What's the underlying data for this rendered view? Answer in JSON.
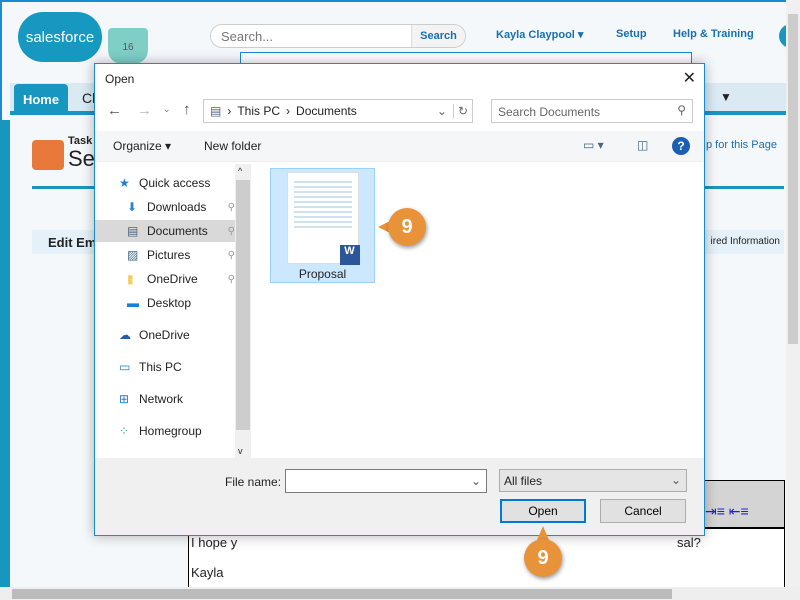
{
  "header": {
    "logo": "salesforce",
    "mug_badge": "16",
    "search_placeholder": "Search...",
    "search_button": "Search",
    "user": "Kayla Claypool",
    "setup": "Setup",
    "help": "Help & Training"
  },
  "tabs": {
    "home": "Home",
    "next": "Cl"
  },
  "page": {
    "breadcrumb": "Task",
    "title": "Se",
    "help_link": "p for this Page",
    "edit_header": "Edit Em",
    "required": "ired Information",
    "body_line1": "I hope y",
    "body_line1_end": "sal?",
    "signature": "Kayla"
  },
  "dialog": {
    "title": "Open",
    "path": [
      "This PC",
      "Documents"
    ],
    "search_placeholder": "Search Documents",
    "organize": "Organize",
    "new_folder": "New folder",
    "nav": [
      {
        "label": "Quick access",
        "icon": "star-icon"
      },
      {
        "label": "Downloads",
        "icon": "download-icon",
        "pinned": true
      },
      {
        "label": "Documents",
        "icon": "document-icon",
        "pinned": true,
        "selected": true
      },
      {
        "label": "Pictures",
        "icon": "pictures-icon",
        "pinned": true
      },
      {
        "label": "OneDrive",
        "icon": "folder-icon",
        "pinned": true
      },
      {
        "label": "Desktop",
        "icon": "desktop-icon"
      },
      {
        "label": "OneDrive",
        "icon": "cloud-icon"
      },
      {
        "label": "This PC",
        "icon": "computer-icon"
      },
      {
        "label": "Network",
        "icon": "network-icon"
      },
      {
        "label": "Homegroup",
        "icon": "homegroup-icon"
      }
    ],
    "file": {
      "name": "Proposal",
      "type": "word-document"
    },
    "filename_label": "File name:",
    "filename_value": "",
    "filter": "All files",
    "open": "Open",
    "cancel": "Cancel"
  },
  "callouts": {
    "file": "9",
    "open": "9"
  },
  "colors": {
    "accent": "#1797c0",
    "callout": "#e8923a",
    "selection": "#cce8ff"
  }
}
